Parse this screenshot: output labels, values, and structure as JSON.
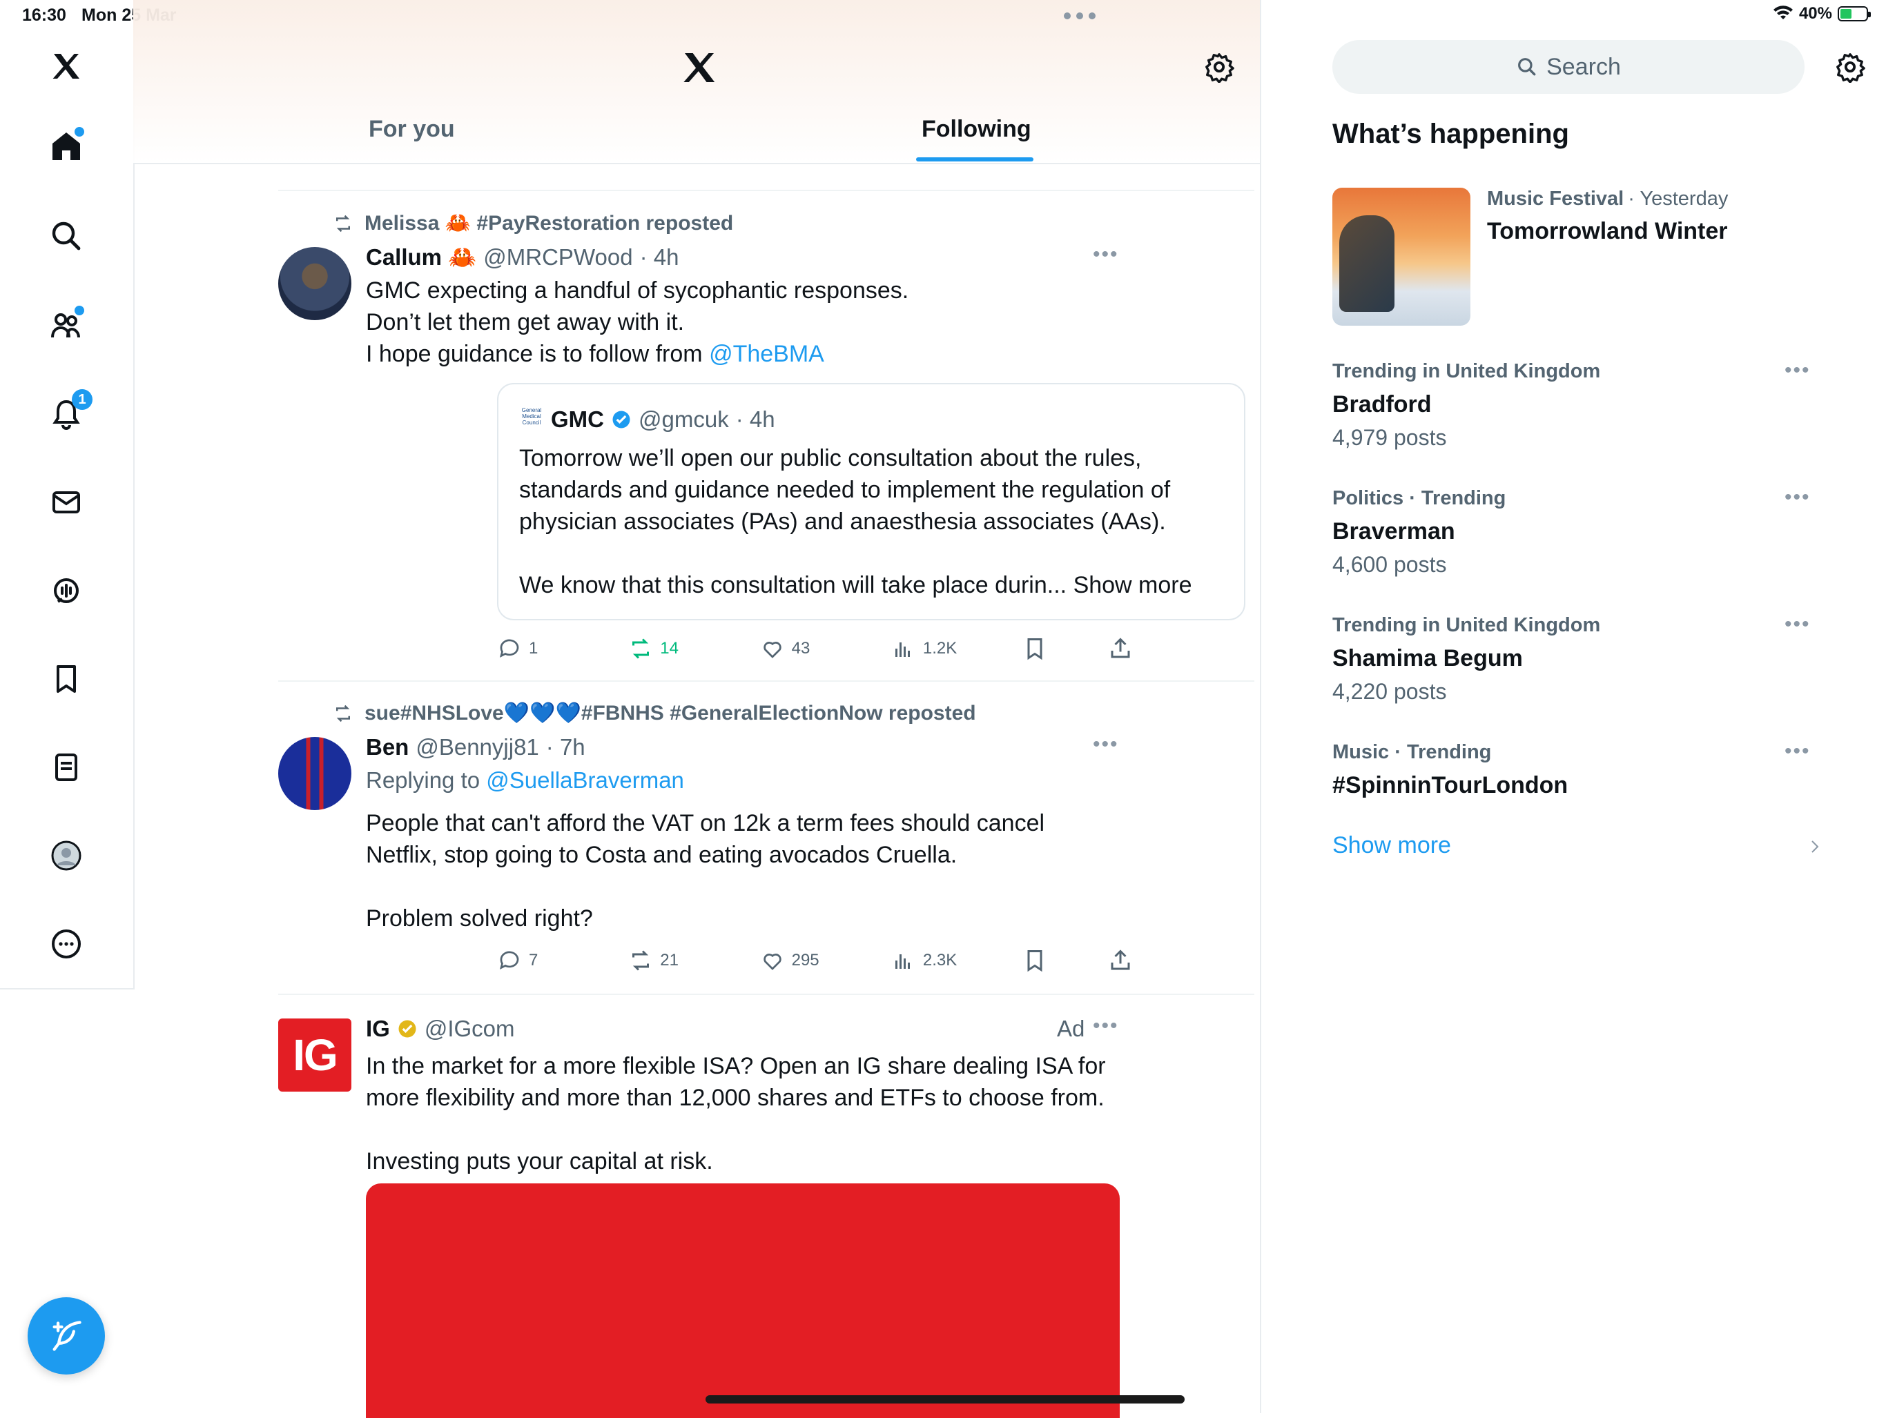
{
  "status_bar": {
    "time": "16:30",
    "date": "Mon 25 Mar",
    "battery": "40%"
  },
  "tabs": [
    {
      "label": "For you"
    },
    {
      "label": "Following"
    }
  ],
  "feed": [
    {
      "repost_by": "Melissa 🦀 #PayRestoration reposted",
      "name": "Callum 🦀",
      "handle": "@MRCPWood",
      "time": "· 4h",
      "text_lines": [
        "GMC expecting a handful of sycophantic responses.",
        "Don’t let them get away with it.",
        "I hope guidance is to follow from"
      ],
      "mention": "@TheBMA",
      "quote": {
        "name": "GMC",
        "handle": "@gmcuk",
        "time": "· 4h",
        "text_lines": [
          "Tomorrow we’ll open our public consultation about the rules,",
          "standards and guidance needed to implement the regulation of",
          "physician associates (PAs) and anaesthesia associates (AAs)."
        ],
        "text_last": "We know that this consultation will take place durin...",
        "show_more": "Show more"
      },
      "replies": "1",
      "reposts": "14",
      "likes": "43",
      "views": "1.2K"
    },
    {
      "repost_by": "sue#NHSLove💙💙💙#FBNHS #GeneralElectionNow reposted",
      "name": "Ben",
      "handle": "@Bennyjj81",
      "time": "· 7h",
      "replying_prefix": "Replying to",
      "replying_to": "@SuellaBraverman",
      "text_lines": [
        "People that can't afford the VAT on 12k a term fees should cancel",
        "Netflix, stop going to Costa and eating avocados Cruella."
      ],
      "text_last": "Problem solved right?",
      "replies": "7",
      "reposts": "21",
      "likes": "295",
      "views": "2.3K"
    },
    {
      "name": "IG",
      "handle": "@IGcom",
      "ad_label": "Ad",
      "logo_text": "IG",
      "text_lines": [
        "In the market for a more flexible ISA? Open an IG share dealing ISA for",
        "more flexibility and more than 12,000 shares and ETFs to choose from."
      ],
      "text_last": "Investing puts your capital at risk."
    }
  ],
  "notifications_badge": "1",
  "sidebar": {
    "search_placeholder": "Search",
    "section_title": "What’s happening",
    "event": {
      "category": "Music Festival",
      "when": "· Yesterday",
      "title": "Tomorrowland Winter"
    },
    "trends": [
      {
        "meta": "Trending in United Kingdom",
        "name": "Bradford",
        "count": "4,979 posts"
      },
      {
        "meta": "Politics · Trending",
        "name": "Braverman",
        "count": "4,600 posts"
      },
      {
        "meta": "Trending in United Kingdom",
        "name": "Shamima Begum",
        "count": "4,220 posts"
      },
      {
        "meta": "Music · Trending",
        "name": "#SpinninTourLondon",
        "count": ""
      }
    ],
    "show_more": "Show more"
  },
  "colors": {
    "accent": "#1d9bf0",
    "repost_green": "#00ba7c",
    "ad_red": "#e31e24"
  },
  "icons": [
    "x-logo-icon",
    "home-icon",
    "search-icon",
    "communities-icon",
    "bell-icon",
    "mail-icon",
    "spaces-icon",
    "bookmark-icon",
    "lists-icon",
    "profile-icon",
    "more-icon",
    "compose-icon",
    "settings-icon",
    "repost-icon",
    "reply-icon",
    "like-icon",
    "views-icon",
    "share-icon",
    "verified-icon",
    "chevron-right-icon"
  ]
}
